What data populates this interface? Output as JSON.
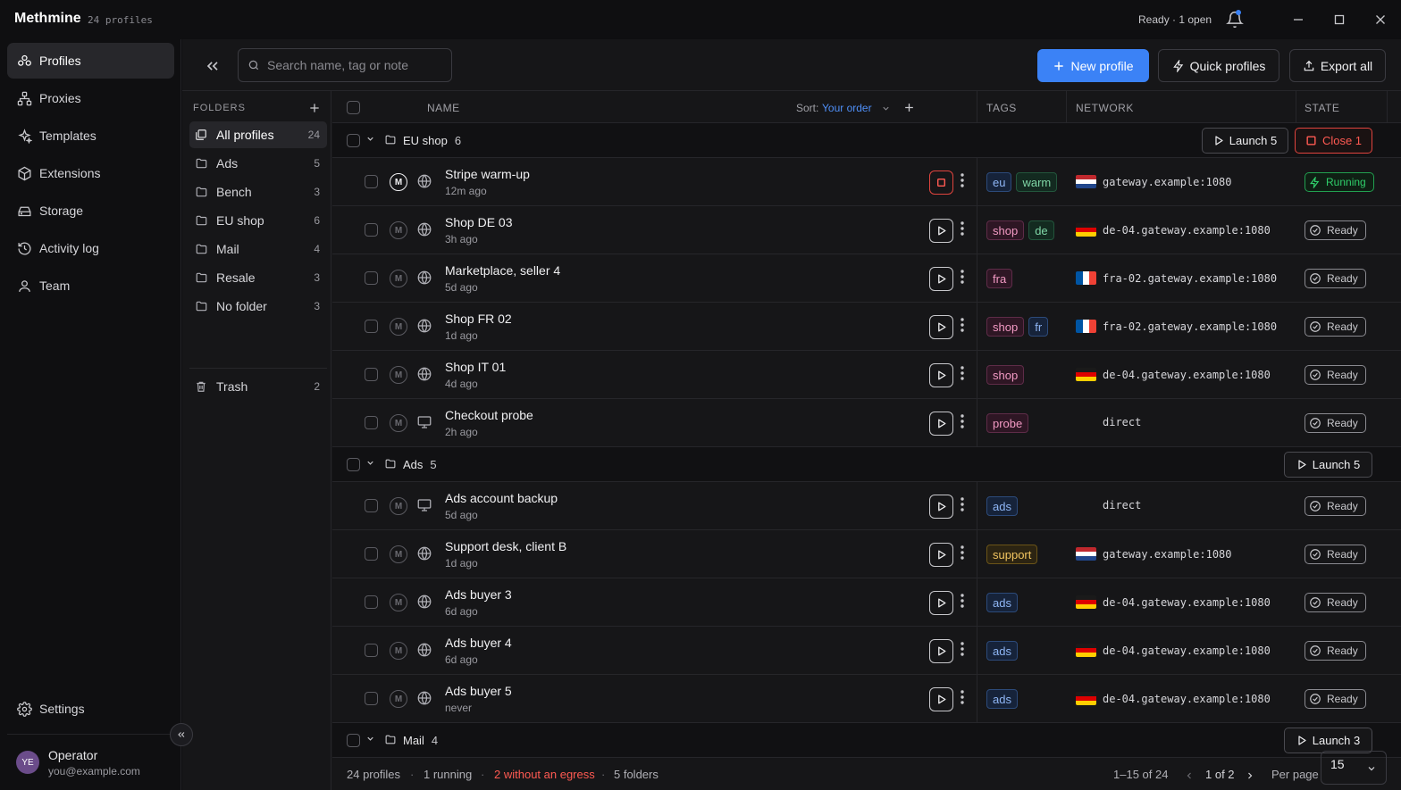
{
  "app": {
    "name": "Methmine",
    "profile_count": "24 profiles",
    "status": "Ready · 1 open"
  },
  "sidebar": {
    "items": [
      {
        "label": "Profiles",
        "icon": "profiles-icon",
        "active": true
      },
      {
        "label": "Proxies",
        "icon": "proxies-icon"
      },
      {
        "label": "Templates",
        "icon": "templates-icon"
      },
      {
        "label": "Extensions",
        "icon": "extensions-icon"
      },
      {
        "label": "Storage",
        "icon": "storage-icon"
      },
      {
        "label": "Activity log",
        "icon": "activity-log-icon"
      },
      {
        "label": "Team",
        "icon": "team-icon"
      }
    ],
    "settings": "Settings",
    "user": {
      "initials": "YE",
      "name": "Operator",
      "email": "you@example.com"
    }
  },
  "toolbar": {
    "search_placeholder": "Search name, tag or note",
    "new_profile": "New profile",
    "quick_profiles": "Quick profiles",
    "export_all": "Export all"
  },
  "folders": {
    "header": "FOLDERS",
    "items": [
      {
        "label": "All profiles",
        "count": "24",
        "active": true
      },
      {
        "label": "Ads",
        "count": "5"
      },
      {
        "label": "Bench",
        "count": "3"
      },
      {
        "label": "EU shop",
        "count": "6"
      },
      {
        "label": "Mail",
        "count": "4"
      },
      {
        "label": "Resale",
        "count": "3"
      },
      {
        "label": "No folder",
        "count": "3"
      }
    ],
    "trash": {
      "label": "Trash",
      "count": "2"
    }
  },
  "table": {
    "headers": {
      "name": "NAME",
      "sort_label": "Sort:",
      "sort_value": "Your order",
      "tags": "TAGS",
      "network": "NETWORK",
      "state": "STATE"
    },
    "groups": [
      {
        "name": "EU shop",
        "count": "6",
        "launch": "Launch 5",
        "close": "Close 1",
        "rows": [
          {
            "name": "Stripe warm-up",
            "time": "12m ago",
            "running": true,
            "kind": "globe",
            "tags": [
              [
                "eu",
                "blue"
              ],
              [
                "warm",
                "green"
              ]
            ],
            "flag": "nl",
            "network": "gateway.example:1080",
            "state": "Running"
          },
          {
            "name": "Shop DE 03",
            "time": "3h ago",
            "kind": "globe",
            "tags": [
              [
                "shop",
                "pink"
              ],
              [
                "de",
                "green"
              ]
            ],
            "flag": "de",
            "network": "de-04.gateway.example:1080",
            "state": "Ready"
          },
          {
            "name": "Marketplace, seller 4",
            "time": "5d ago",
            "kind": "globe",
            "tags": [
              [
                "fra",
                "pink"
              ]
            ],
            "flag": "fr",
            "network": "fra-02.gateway.example:1080",
            "state": "Ready"
          },
          {
            "name": "Shop FR 02",
            "time": "1d ago",
            "kind": "globe",
            "tags": [
              [
                "shop",
                "pink"
              ],
              [
                "fr",
                "blue"
              ]
            ],
            "flag": "fr",
            "network": "fra-02.gateway.example:1080",
            "state": "Ready"
          },
          {
            "name": "Shop IT 01",
            "time": "4d ago",
            "kind": "globe",
            "tags": [
              [
                "shop",
                "pink"
              ]
            ],
            "flag": "de",
            "network": "de-04.gateway.example:1080",
            "state": "Ready"
          },
          {
            "name": "Checkout probe",
            "time": "2h ago",
            "kind": "monitor",
            "tags": [
              [
                "probe",
                "pink"
              ]
            ],
            "flag": "",
            "network": "direct",
            "state": "Ready"
          }
        ]
      },
      {
        "name": "Ads",
        "count": "5",
        "launch": "Launch 5",
        "rows": [
          {
            "name": "Ads account backup",
            "time": "5d ago",
            "kind": "monitor",
            "tags": [
              [
                "ads",
                "blue"
              ]
            ],
            "flag": "",
            "network": "direct",
            "state": "Ready"
          },
          {
            "name": "Support desk, client B",
            "time": "1d ago",
            "kind": "globe",
            "tags": [
              [
                "support",
                "yellow"
              ]
            ],
            "flag": "nl",
            "network": "gateway.example:1080",
            "state": "Ready"
          },
          {
            "name": "Ads buyer 3",
            "time": "6d ago",
            "kind": "globe",
            "tags": [
              [
                "ads",
                "blue"
              ]
            ],
            "flag": "de",
            "network": "de-04.gateway.example:1080",
            "state": "Ready"
          },
          {
            "name": "Ads buyer 4",
            "time": "6d ago",
            "kind": "globe",
            "tags": [
              [
                "ads",
                "blue"
              ]
            ],
            "flag": "de",
            "network": "de-04.gateway.example:1080",
            "state": "Ready"
          },
          {
            "name": "Ads buyer 5",
            "time": "never",
            "kind": "globe",
            "tags": [
              [
                "ads",
                "blue"
              ]
            ],
            "flag": "de",
            "network": "de-04.gateway.example:1080",
            "state": "Ready"
          }
        ]
      },
      {
        "name": "Mail",
        "count": "4",
        "launch": "Launch 3",
        "rows": []
      }
    ]
  },
  "footer": {
    "profiles": "24 profiles",
    "running": "1 running",
    "without_egress": "2 without an egress",
    "folders": "5 folders",
    "range": "1–15 of 24",
    "page": "1 of 2",
    "per_page_label": "Per page",
    "per_page_value": "15"
  },
  "colors": {
    "accent": "#3b82f6",
    "danger": "#ff5a52",
    "running": "#2fcf6a"
  }
}
